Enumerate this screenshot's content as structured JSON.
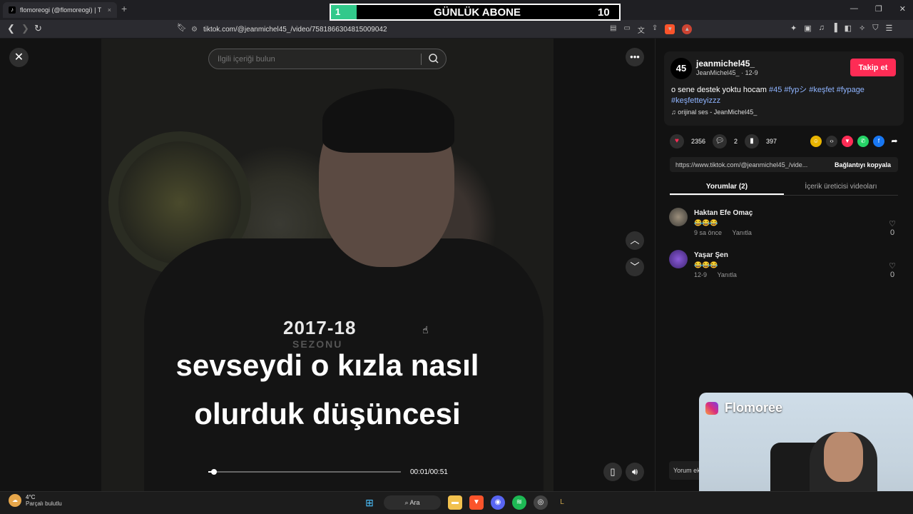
{
  "browser": {
    "tab_title": "flomoreogi (@flomoreogi) | T",
    "new_tab": "+",
    "url": "tiktok.com/@jeanmichel45_/video/7581866304815009042"
  },
  "counter": {
    "left_value": "1",
    "title": "GÜNLÜK ABONE",
    "right_value": "10"
  },
  "search": {
    "placeholder": "İlgili içeriği bulun"
  },
  "video": {
    "caption_year": "2017-18",
    "caption_sezon": "SEZONU",
    "caption_line1": "sevseydi o kızla nasıl",
    "caption_line2": "olurduk düşüncesi",
    "time": "00:01/00:51",
    "progress": 0.03
  },
  "post": {
    "avatar_text": "45",
    "username": "jeanmichel45_",
    "display_name": "JeanMichel45_",
    "date": "12-9",
    "follow_label": "Takip et",
    "desc_text": "o sene destek yoktu hocam ",
    "hashtags": [
      "#45",
      "#fypシ",
      "#keşfet",
      "#fypage",
      "#keşfetteyizzz"
    ],
    "music": "orijinal ses - JeanMichel45_",
    "likes": "2356",
    "comments": "2",
    "saves": "397",
    "share_link": "https://www.tiktok.com/@jeanmichel45_/vide...",
    "copy_label": "Bağlantıyı kopyala"
  },
  "tabs": {
    "comments": "Yorumlar (2)",
    "creator_videos": "İçerik üreticisi videoları"
  },
  "comments": [
    {
      "name": "Haktan Efe Omaç",
      "text": "😂😂😂",
      "time": "9 sa önce",
      "reply": "Yanıtla",
      "likes": "0"
    },
    {
      "name": "Yaşar Şen",
      "text": "😂😂😂",
      "time": "12-9",
      "reply": "Yanıtla",
      "likes": "0"
    }
  ],
  "comment_input": {
    "placeholder": "Yorum ekle..."
  },
  "cam": {
    "name": "Flomoree"
  },
  "taskbar": {
    "temp": "4°C",
    "weather": "Parçalı bulutlu",
    "search": "Ara"
  },
  "colors": {
    "accent": "#fe2c55",
    "hashtag": "#8fb4ff",
    "counter_green": "#31c98b"
  }
}
